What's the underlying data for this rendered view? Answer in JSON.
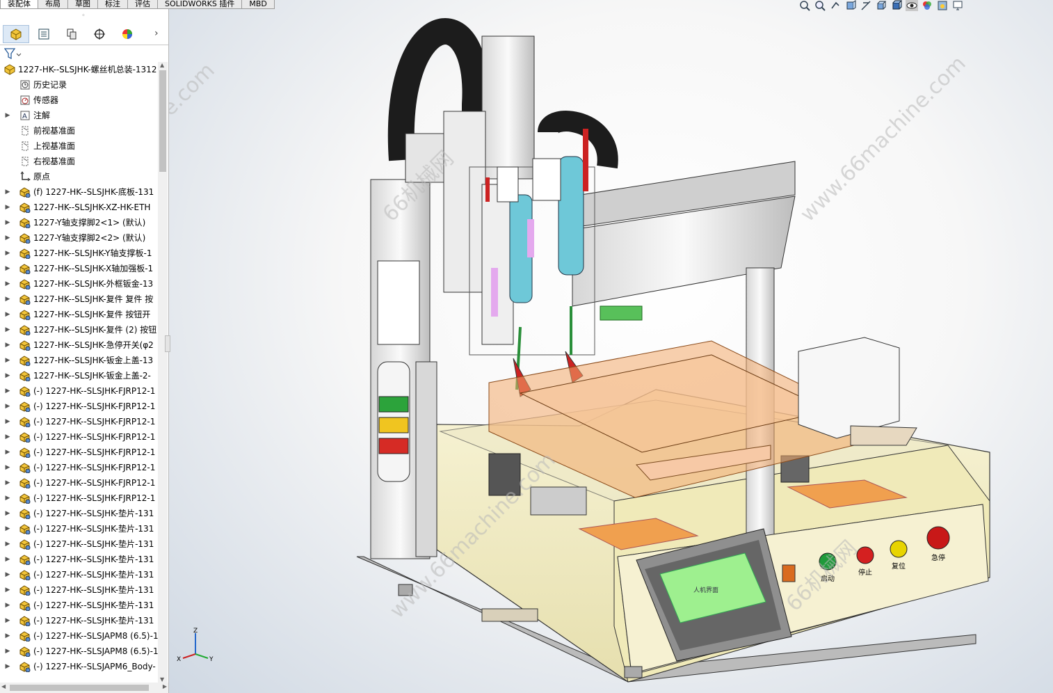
{
  "command_tabs": [
    "装配体",
    "布局",
    "草图",
    "标注",
    "评估",
    "SOLIDWORKS 插件",
    "MBD"
  ],
  "panel_tabs": [
    {
      "icon": "featuremanager-icon"
    },
    {
      "icon": "propertymanager-icon"
    },
    {
      "icon": "configurationmanager-icon"
    },
    {
      "icon": "dimxpert-icon"
    },
    {
      "icon": "display-manager-icon"
    }
  ],
  "tree": {
    "root": "1227-HK--SLSJHK-螺丝机总装-1312",
    "items": [
      {
        "label": "历史记录",
        "icon": "history-icon",
        "expand": false
      },
      {
        "label": "传感器",
        "icon": "sensor-icon",
        "expand": false
      },
      {
        "label": "注解",
        "icon": "annotation-icon",
        "expand": true
      },
      {
        "label": "前视基准面",
        "icon": "plane-icon",
        "expand": false
      },
      {
        "label": "上视基准面",
        "icon": "plane-icon",
        "expand": false
      },
      {
        "label": "右视基准面",
        "icon": "plane-icon",
        "expand": false
      },
      {
        "label": "原点",
        "icon": "origin-icon",
        "expand": false
      },
      {
        "label": "(f) 1227-HK--SLSJHK-底板-131",
        "icon": "part-icon",
        "expand": true
      },
      {
        "label": "1227-HK--SLSJHK-XZ-HK-ETH",
        "icon": "part-icon",
        "expand": true
      },
      {
        "label": "1227-Y轴支撑脚2<1> (默认)",
        "icon": "part-icon",
        "expand": true
      },
      {
        "label": "1227-Y轴支撑脚2<2> (默认)",
        "icon": "part-icon",
        "expand": true
      },
      {
        "label": "1227-HK--SLSJHK-Y轴支撑板-1",
        "icon": "part-icon",
        "expand": true
      },
      {
        "label": "1227-HK--SLSJHK-X轴加强板-1",
        "icon": "part-icon",
        "expand": true
      },
      {
        "label": "1227-HK--SLSJHK-外框钣金-13",
        "icon": "part-icon",
        "expand": true
      },
      {
        "label": "1227-HK--SLSJHK-复件 复件 按",
        "icon": "part-icon",
        "expand": true
      },
      {
        "label": "1227-HK--SLSJHK-复件 按钮开",
        "icon": "part-icon",
        "expand": true
      },
      {
        "label": "1227-HK--SLSJHK-复件 (2) 按钮",
        "icon": "part-icon",
        "expand": true
      },
      {
        "label": "1227-HK--SLSJHK-急停开关(φ2",
        "icon": "part-icon",
        "expand": true
      },
      {
        "label": "1227-HK--SLSJHK-钣金上盖-13",
        "icon": "part-icon",
        "expand": true
      },
      {
        "label": "1227-HK--SLSJHK-钣金上盖-2-",
        "icon": "part-icon",
        "expand": true
      },
      {
        "label": "(-) 1227-HK--SLSJHK-FJRP12-1",
        "icon": "part-icon",
        "expand": true
      },
      {
        "label": "(-) 1227-HK--SLSJHK-FJRP12-1",
        "icon": "part-icon",
        "expand": true
      },
      {
        "label": "(-) 1227-HK--SLSJHK-FJRP12-1",
        "icon": "part-icon",
        "expand": true
      },
      {
        "label": "(-) 1227-HK--SLSJHK-FJRP12-1",
        "icon": "part-icon",
        "expand": true
      },
      {
        "label": "(-) 1227-HK--SLSJHK-FJRP12-1",
        "icon": "part-icon",
        "expand": true
      },
      {
        "label": "(-) 1227-HK--SLSJHK-FJRP12-1",
        "icon": "part-icon",
        "expand": true
      },
      {
        "label": "(-) 1227-HK--SLSJHK-FJRP12-1",
        "icon": "part-icon",
        "expand": true
      },
      {
        "label": "(-) 1227-HK--SLSJHK-FJRP12-1",
        "icon": "part-icon",
        "expand": true
      },
      {
        "label": "(-) 1227-HK--SLSJHK-垫片-131",
        "icon": "part-icon",
        "expand": true
      },
      {
        "label": "(-) 1227-HK--SLSJHK-垫片-131",
        "icon": "part-icon",
        "expand": true
      },
      {
        "label": "(-) 1227-HK--SLSJHK-垫片-131",
        "icon": "part-icon",
        "expand": true
      },
      {
        "label": "(-) 1227-HK--SLSJHK-垫片-131",
        "icon": "part-icon",
        "expand": true
      },
      {
        "label": "(-) 1227-HK--SLSJHK-垫片-131",
        "icon": "part-icon",
        "expand": true
      },
      {
        "label": "(-) 1227-HK--SLSJHK-垫片-131",
        "icon": "part-icon",
        "expand": true
      },
      {
        "label": "(-) 1227-HK--SLSJHK-垫片-131",
        "icon": "part-icon",
        "expand": true
      },
      {
        "label": "(-) 1227-HK--SLSJHK-垫片-131",
        "icon": "part-icon",
        "expand": true
      },
      {
        "label": "(-) 1227-HK--SLSJAPM8 (6.5)-1",
        "icon": "part-icon",
        "expand": true
      },
      {
        "label": "(-) 1227-HK--SLSJAPM8 (6.5)-1",
        "icon": "part-icon",
        "expand": true
      },
      {
        "label": "(-) 1227-HK--SLSJAPM6_Body-",
        "icon": "part-icon",
        "expand": true
      }
    ]
  },
  "machine_panel": {
    "hmi_text": "人机界面",
    "buttons": [
      {
        "label": "启动",
        "color": "#1f9a3a"
      },
      {
        "label": "停止",
        "color": "#d42020"
      },
      {
        "label": "复位",
        "color": "#e8d400"
      },
      {
        "label": "急停",
        "color": "#c81818"
      }
    ]
  },
  "watermark": {
    "text_en": "www.66machine.com",
    "text_cn": "66机械网"
  },
  "triad": {
    "x": "X",
    "y": "Y",
    "z": "Z"
  },
  "colors": {
    "machine_body": "#f3eec6",
    "hmi_screen": "#9ef08f",
    "tray": "#f2a96b",
    "accent_blue": "#2266cc"
  }
}
